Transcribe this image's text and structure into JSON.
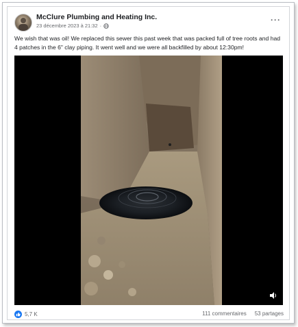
{
  "post": {
    "page_name": "McClure Plumbing and Heating Inc.",
    "date": "23 décembre 2023 à 21:32",
    "separator": "·",
    "text": "We wish that was oil! We replaced this sewer this past week that was packed full of tree roots and had 4 patches in the 6\" clay piping. It went well and we were all backfilled by about 12:30pm!",
    "more_label": "···"
  },
  "footer": {
    "reactions": "5,7 K",
    "comments": "111 commentaires",
    "shares": "53 partages"
  },
  "icons": {
    "audience": "globe-icon",
    "reaction": "like-icon",
    "media_control": "speaker-icon"
  },
  "colors": {
    "brand_blue": "#1877f2",
    "text_primary": "#1c1e21",
    "text_secondary": "#65676b"
  }
}
